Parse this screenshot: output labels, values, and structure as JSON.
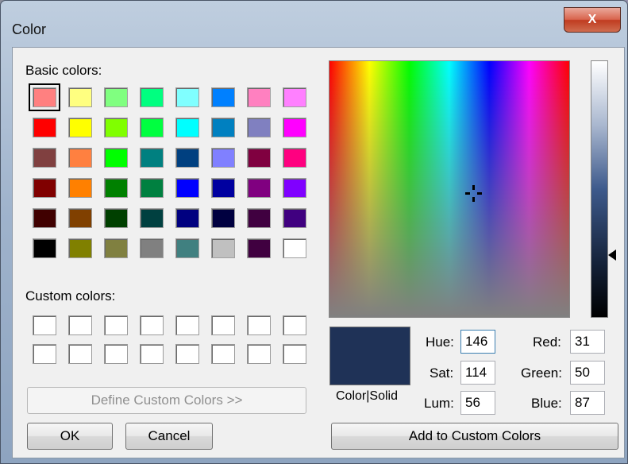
{
  "window": {
    "title": "Color",
    "close_label": "X"
  },
  "basic": {
    "label": "Basic colors:",
    "colors": [
      "#ff8080",
      "#ffff80",
      "#80ff80",
      "#00ff80",
      "#80ffff",
      "#0080ff",
      "#ff80c0",
      "#ff80ff",
      "#ff0000",
      "#ffff00",
      "#80ff00",
      "#00ff40",
      "#00ffff",
      "#0080c0",
      "#8080c0",
      "#ff00ff",
      "#804040",
      "#ff8040",
      "#00ff00",
      "#008080",
      "#004080",
      "#8080ff",
      "#800040",
      "#ff0080",
      "#800000",
      "#ff8000",
      "#008000",
      "#008040",
      "#0000ff",
      "#0000a0",
      "#800080",
      "#8000ff",
      "#400000",
      "#804000",
      "#004000",
      "#004040",
      "#000080",
      "#000040",
      "#400040",
      "#400080",
      "#000000",
      "#808000",
      "#808040",
      "#808080",
      "#408080",
      "#c0c0c0",
      "#400040",
      "#ffffff"
    ],
    "selected_index": 0
  },
  "custom": {
    "label": "Custom colors:"
  },
  "buttons": {
    "define": "Define Custom Colors >>",
    "ok": "OK",
    "cancel": "Cancel",
    "add": "Add to Custom Colors"
  },
  "preview": {
    "label": "Color|Solid",
    "color": "#1f3257"
  },
  "fields": {
    "hue": {
      "label": "Hue:",
      "value": "146"
    },
    "sat": {
      "label": "Sat:",
      "value": "114"
    },
    "lum": {
      "label": "Lum:",
      "value": "56"
    },
    "red": {
      "label": "Red:",
      "value": "31"
    },
    "green": {
      "label": "Green:",
      "value": "50"
    },
    "blue": {
      "label": "Blue:",
      "value": "87"
    }
  }
}
